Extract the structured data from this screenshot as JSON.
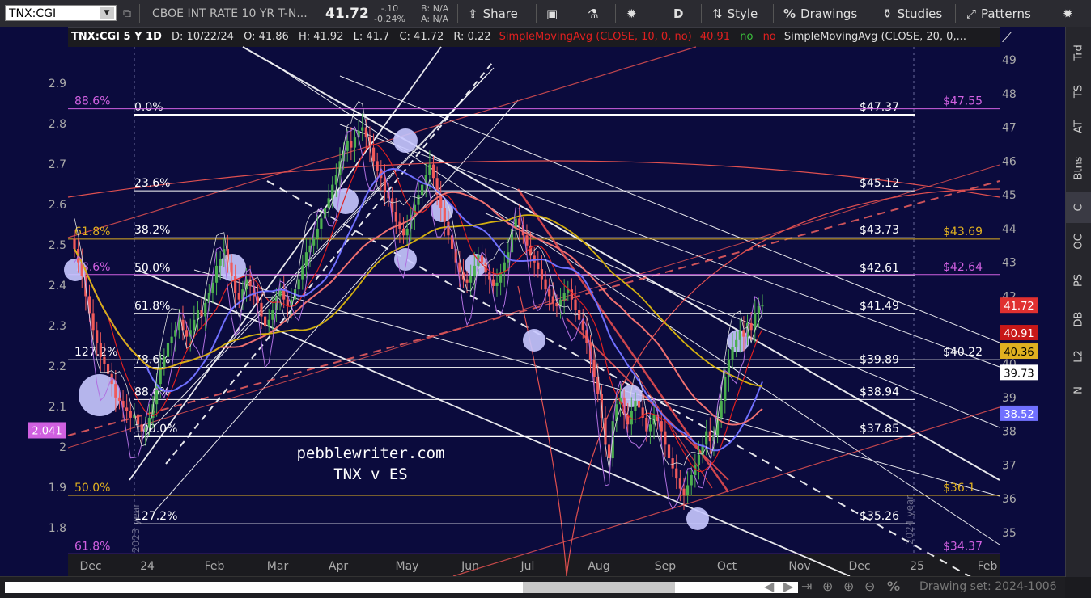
{
  "toolbar": {
    "symbol": "TNX:CGI",
    "description": "CBOE INT RATE 10 YR T-N...",
    "last": "41.72",
    "net_change": "-.10",
    "pct_change": "-0.24%",
    "bid": "B: N/A",
    "ask": "A: N/A",
    "share_label": "Share",
    "aggregation": "D",
    "style_label": "Style",
    "drawings_label": "Drawings",
    "studies_label": "Studies",
    "patterns_label": "Patterns",
    "share_icon": "share-arrow-icon",
    "settings_icon": "gear-icon",
    "flask_icon": "flask-icon"
  },
  "header": {
    "symbol_period": "TNX:CGI 5 Y 1D",
    "date": "D: 10/22/24",
    "open": "O: 41.86",
    "high": "H: 41.92",
    "low": "L: 41.7",
    "close": "C: 41.72",
    "range": "R: 0.22",
    "sma10": "SimpleMovingAvg (CLOSE, 10, 0, no)",
    "sma10_value": "40.91",
    "sma10_flag1": "no",
    "sma10_flag2": "no",
    "sma20": "SimpleMovingAvg (CLOSE, 20, 0,..."
  },
  "right_tabs": [
    "Trd",
    "TS",
    "AT",
    "Btns",
    "C",
    "OC",
    "PS",
    "DB",
    "L2",
    "N"
  ],
  "scroll": {
    "drawing_set": "Drawing set: 2024-1006"
  },
  "watermark": {
    "line1": "pebblewriter.com",
    "line2": "TNX v ES"
  },
  "colors": {
    "bg": "#0b0b3d",
    "up": "#4caf50",
    "down": "#f05a5a",
    "sma10": "#e02020",
    "sma20": "#7070ff",
    "sma50": "#f07070",
    "sma200": "#d4b010",
    "fib_white": "#ffffff",
    "fib_gold": "#e0b020",
    "fib_magenta": "#d060e0",
    "highlight": "#c8c8ff"
  },
  "chart_data": {
    "type": "candlestick",
    "title": "TNX:CGI 5 Y 1D",
    "x_ticks": [
      "Dec",
      "24",
      "Feb",
      "Mar",
      "Apr",
      "May",
      "Jun",
      "Jul",
      "Aug",
      "Sep",
      "Oct",
      "Nov",
      "Dec",
      "25",
      "Feb"
    ],
    "year_markers": [
      "2023 year",
      "2024 year"
    ],
    "y_left": {
      "ticks": [
        "2.9",
        "2.8",
        "2.7",
        "2.6",
        "2.5",
        "2.4",
        "2.3",
        "2.2",
        "2.1",
        "2",
        "1.9",
        "1.8"
      ],
      "range": [
        1.75,
        2.98
      ],
      "current_label": "2.041"
    },
    "y_right": {
      "ticks": [
        49,
        48,
        47,
        46,
        45,
        44,
        43,
        42,
        41,
        40,
        39,
        38,
        37,
        36,
        35
      ],
      "range": [
        34.4,
        49.5
      ]
    },
    "price_labels": [
      {
        "value": 41.72,
        "text": "41.72",
        "bg": "#e03030",
        "fg": "#ffffff"
      },
      {
        "value": 40.91,
        "text": "40.91",
        "bg": "#c81818",
        "fg": "#ffffff"
      },
      {
        "value": 40.36,
        "text": "40.36",
        "bg": "#e0b020",
        "fg": "#000000"
      },
      {
        "value": 39.73,
        "text": "39.73",
        "bg": "#ffffff",
        "fg": "#000000"
      },
      {
        "value": 38.52,
        "text": "38.52",
        "bg": "#7070ff",
        "fg": "#ffffff"
      }
    ],
    "fib_lines": [
      {
        "value": 47.37,
        "pct": "0.0%",
        "price": "$47.37",
        "color": "white",
        "thick": true
      },
      {
        "value": 45.12,
        "pct": "23.6%",
        "price": "$45.12",
        "color": "white"
      },
      {
        "value": 43.73,
        "pct": "38.2%",
        "price": "$43.73",
        "color": "gold"
      },
      {
        "value": 42.61,
        "pct": "50.0%",
        "price": "$42.61",
        "color": "white"
      },
      {
        "value": 41.49,
        "pct": "61.8%",
        "price": "$41.49",
        "color": "white"
      },
      {
        "value": 39.89,
        "pct": "78.6%",
        "price": "$39.89",
        "color": "white"
      },
      {
        "value": 38.94,
        "pct": "88.6%",
        "price": "$38.94",
        "color": "white"
      },
      {
        "value": 37.85,
        "pct": "100.0%",
        "price": "$37.85",
        "color": "white",
        "thick": true
      },
      {
        "value": 35.26,
        "pct": "127.2%",
        "price": "$35.26",
        "color": "white"
      }
    ],
    "gold_fibs": [
      {
        "value": 43.69,
        "pct": "61.8%",
        "price": "$43.69"
      },
      {
        "value": 36.1,
        "pct": "50.0%",
        "price": "$36.1"
      }
    ],
    "magenta_fibs": [
      {
        "value": 47.55,
        "pct": "88.6%",
        "price": "$47.55"
      },
      {
        "value": 42.64,
        "pct": "78.6%",
        "price": "$42.64"
      },
      {
        "value": 34.37,
        "pct": "61.8%",
        "price": "$34.37"
      }
    ],
    "other_labels": [
      {
        "value": 40.22,
        "pct": "127.2%",
        "price": "$40.22"
      }
    ],
    "candles_close": [
      43.4,
      43.0,
      42.6,
      42.0,
      41.5,
      41.0,
      40.6,
      40.2,
      40.0,
      39.7,
      39.4,
      39.0,
      38.9,
      38.7,
      38.6,
      38.4,
      38.5,
      38.2,
      38.0,
      38.1,
      38.4,
      38.8,
      39.4,
      39.9,
      40.2,
      40.6,
      40.8,
      41.0,
      41.3,
      41.0,
      40.8,
      41.0,
      41.3,
      41.6,
      41.4,
      41.8,
      42.1,
      42.4,
      42.9,
      43.1,
      43.4,
      43.0,
      42.6,
      42.1,
      41.9,
      42.2,
      42.5,
      42.3,
      42.0,
      41.8,
      41.4,
      41.1,
      41.3,
      41.6,
      42.0,
      42.2,
      41.9,
      41.7,
      41.9,
      42.2,
      42.5,
      42.9,
      43.3,
      43.5,
      43.7,
      44.0,
      44.3,
      44.6,
      44.9,
      45.3,
      45.6,
      46.0,
      46.3,
      46.6,
      46.4,
      46.7,
      46.9,
      47.0,
      46.7,
      46.4,
      46.0,
      45.7,
      45.5,
      45.1,
      44.9,
      44.5,
      44.2,
      44.0,
      43.8,
      44.0,
      44.4,
      44.7,
      45.0,
      45.3,
      45.6,
      45.9,
      45.5,
      45.0,
      44.6,
      44.2,
      43.8,
      43.4,
      43.0,
      42.7,
      42.5,
      42.4,
      42.6,
      42.9,
      43.2,
      43.0,
      42.7,
      42.5,
      42.3,
      42.4,
      42.7,
      43.0,
      43.3,
      44.0,
      44.3,
      44.1,
      43.8,
      43.5,
      43.2,
      43.0,
      42.8,
      42.5,
      42.2,
      42.0,
      41.8,
      41.7,
      41.9,
      42.1,
      42.2,
      41.9,
      41.6,
      41.3,
      41.0,
      40.6,
      40.1,
      39.6,
      39.1,
      38.4,
      37.6,
      37.2,
      38.3,
      38.8,
      39.0,
      38.5,
      38.2,
      38.6,
      38.9,
      38.7,
      38.4,
      38.0,
      38.2,
      38.5,
      38.3,
      38.0,
      37.6,
      37.2,
      36.9,
      36.6,
      36.3,
      36.1,
      36.4,
      36.7,
      37.0,
      37.3,
      37.6,
      38.0,
      37.7,
      37.9,
      38.4,
      38.9,
      39.6,
      40.1,
      40.5,
      40.7,
      41.0,
      40.8,
      41.2,
      41.0,
      41.5,
      41.7,
      41.72
    ],
    "highlight_circles": [
      {
        "cx": 123,
        "cy": 455,
        "r": 26
      },
      {
        "cx": 93,
        "cy": 300,
        "r": 14
      },
      {
        "cx": 287,
        "cy": 297,
        "r": 17
      },
      {
        "cx": 427,
        "cy": 215,
        "r": 16
      },
      {
        "cx": 501,
        "cy": 140,
        "r": 15
      },
      {
        "cx": 501,
        "cy": 287,
        "r": 14
      },
      {
        "cx": 546,
        "cy": 227,
        "r": 14
      },
      {
        "cx": 588,
        "cy": 294,
        "r": 14
      },
      {
        "cx": 660,
        "cy": 387,
        "r": 14
      },
      {
        "cx": 780,
        "cy": 456,
        "r": 14
      },
      {
        "cx": 862,
        "cy": 608,
        "r": 14
      },
      {
        "cx": 912,
        "cy": 388,
        "r": 14
      }
    ]
  }
}
